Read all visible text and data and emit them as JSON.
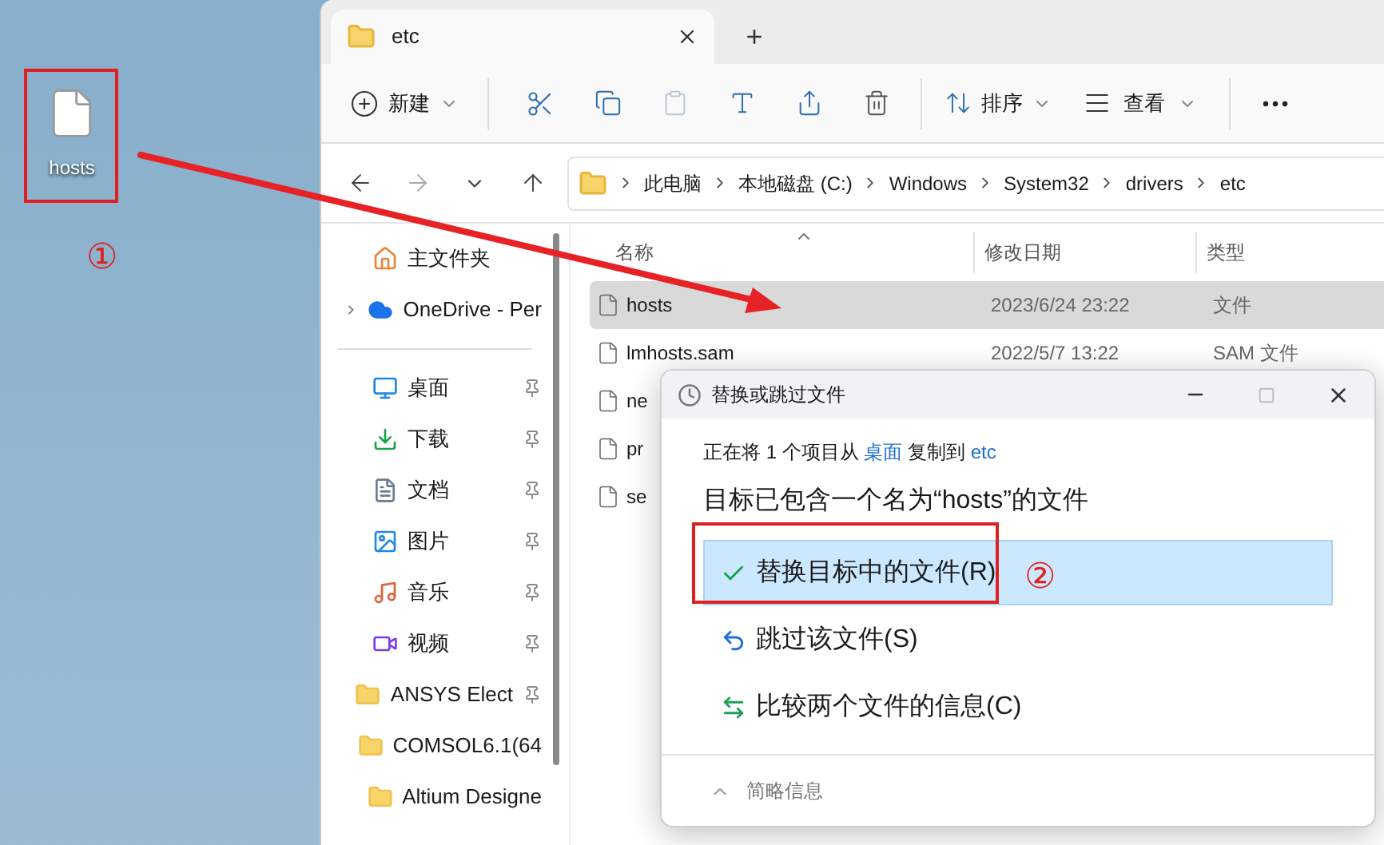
{
  "desktop": {
    "icon": {
      "label": "hosts"
    }
  },
  "annotations": [
    {
      "label": "①"
    },
    {
      "label": "②"
    }
  ],
  "explorer": {
    "tabs": [
      {
        "label": "etc",
        "selected": true
      }
    ],
    "new_tab": "+",
    "toolbar": {
      "new": "新建",
      "sort": "排序",
      "view": "查看"
    },
    "breadcrumb": [
      "此电脑",
      "本地磁盘 (C:)",
      "Windows",
      "System32",
      "drivers",
      "etc"
    ],
    "nav": [
      {
        "kind": "home",
        "label": "主文件夹",
        "pinned": false
      },
      {
        "kind": "cloud",
        "label": "OneDrive - Per",
        "pinned": false,
        "expanded": false
      },
      {
        "kind": "desktop",
        "label": "桌面",
        "pinned": true
      },
      {
        "kind": "download",
        "label": "下载",
        "pinned": true
      },
      {
        "kind": "document",
        "label": "文档",
        "pinned": true
      },
      {
        "kind": "picture",
        "label": "图片",
        "pinned": true
      },
      {
        "kind": "music",
        "label": "音乐",
        "pinned": true
      },
      {
        "kind": "video",
        "label": "视频",
        "pinned": true
      },
      {
        "kind": "folder",
        "label": "ANSYS Elect",
        "pinned": true
      },
      {
        "kind": "folder",
        "label": "COMSOL6.1(64",
        "pinned": false
      },
      {
        "kind": "folder",
        "label": "Altium Designe",
        "pinned": false
      }
    ],
    "columns": [
      "名称",
      "修改日期",
      "类型"
    ],
    "files": [
      {
        "name": "hosts",
        "date": "2023/6/24 23:22",
        "type": "文件",
        "selected": true
      },
      {
        "name": "lmhosts.sam",
        "date": "2022/5/7 13:22",
        "type": "SAM 文件",
        "selected": false
      },
      {
        "name": "ne",
        "selected": false
      },
      {
        "name": "pr",
        "selected": false
      },
      {
        "name": "se",
        "selected": false
      }
    ]
  },
  "dialog": {
    "title": "替换或跳过文件",
    "message": [
      {
        "text": "正在将 1 个项目从 ",
        "link": false
      },
      {
        "text": "桌面",
        "link": true
      },
      {
        "text": " 复制到 ",
        "link": false
      },
      {
        "text": "etc",
        "link": true
      }
    ],
    "heading": "目标已包含一个名为“hosts”的文件",
    "options": [
      {
        "kind": "replace",
        "label": "替换目标中的文件(R)",
        "selected": true
      },
      {
        "kind": "skip",
        "label": "跳过该文件(S)",
        "selected": false
      },
      {
        "kind": "compare",
        "label": "比较两个文件的信息(C)",
        "selected": false
      }
    ],
    "details": "简略信息"
  }
}
